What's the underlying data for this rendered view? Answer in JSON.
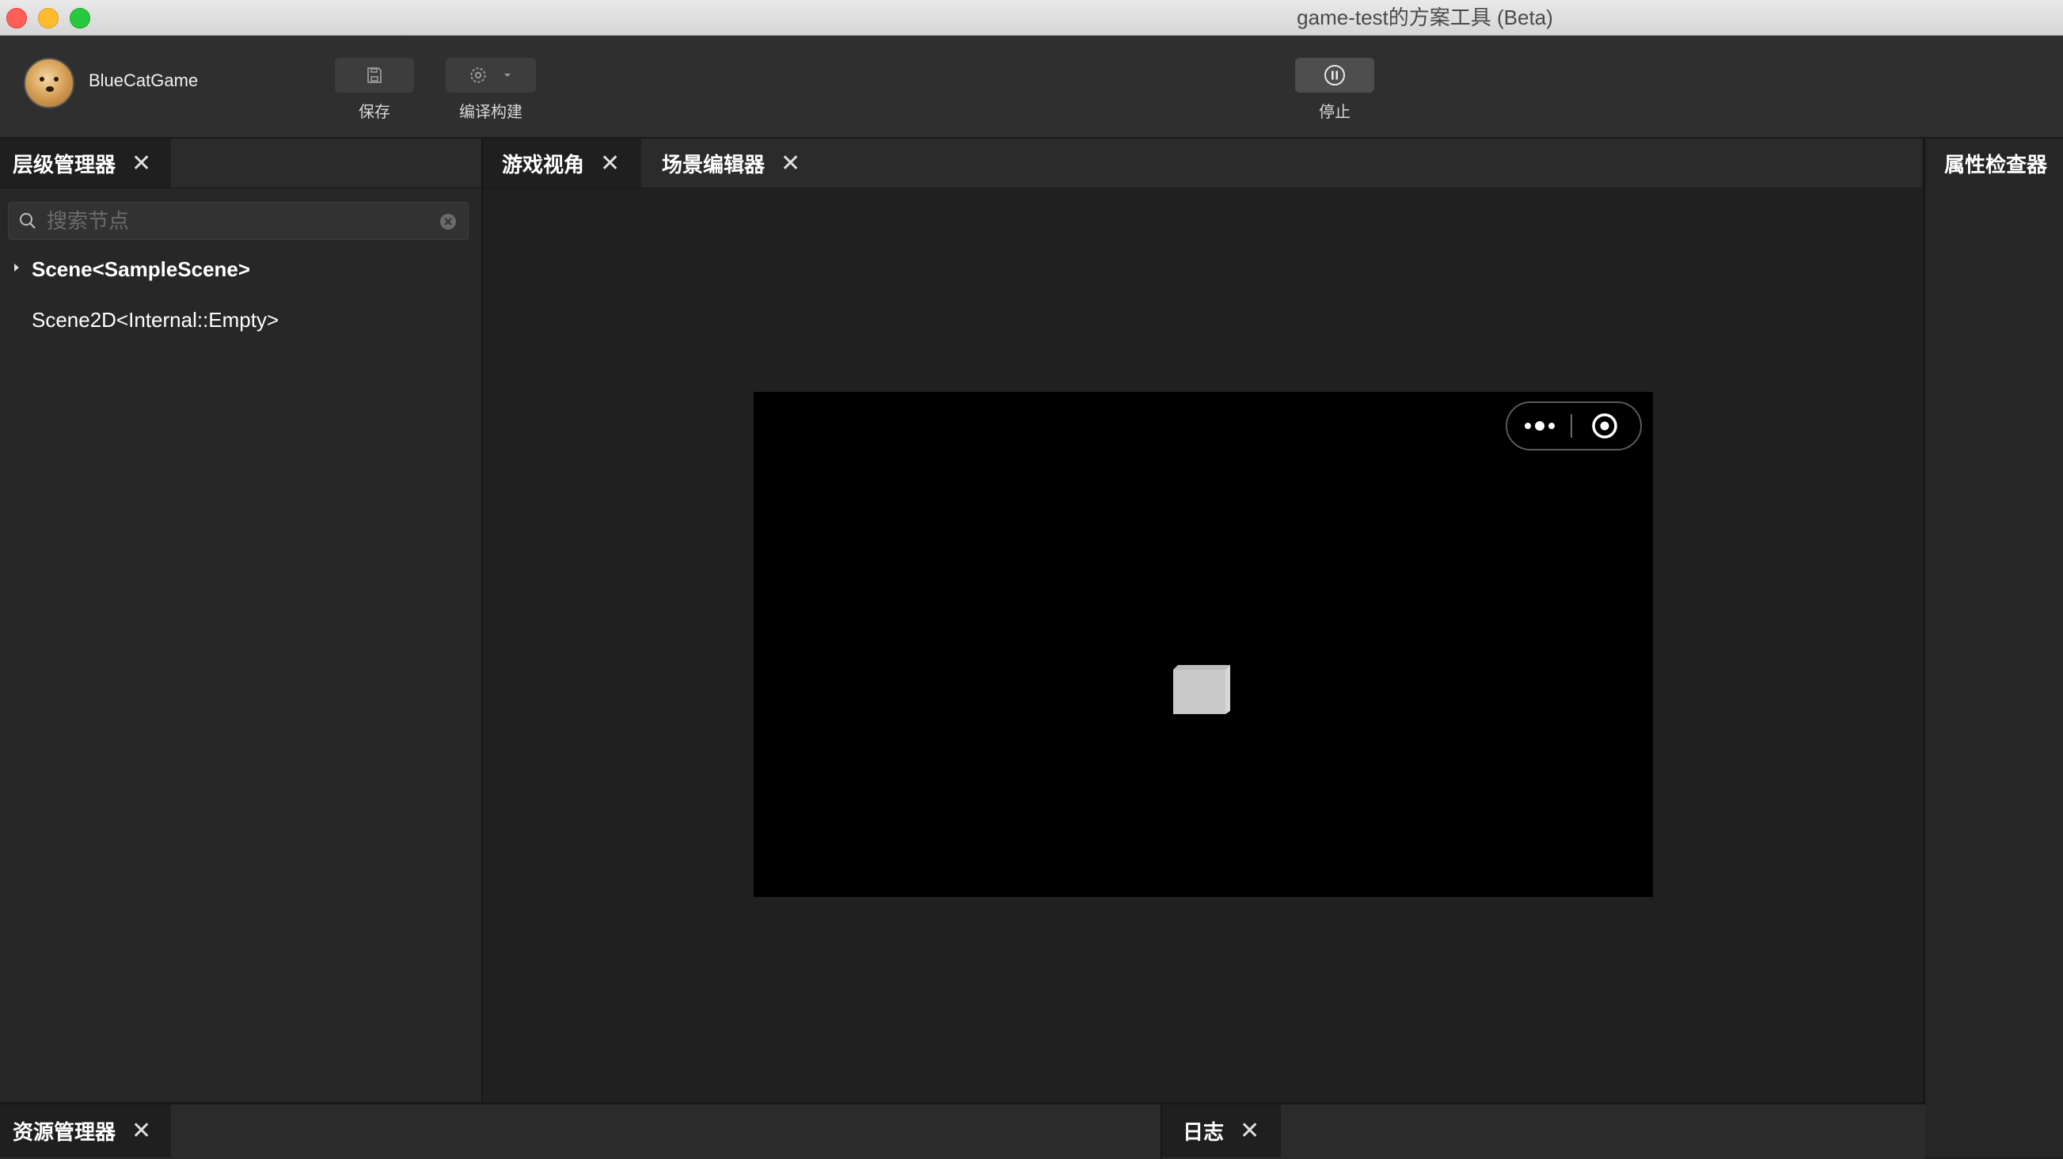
{
  "window": {
    "title": "game-test的方案工具 (Beta)"
  },
  "toolbar": {
    "username": "BlueCatGame",
    "save_label": "保存",
    "build_label": "编译构建",
    "stop_label": "停止"
  },
  "hierarchy": {
    "tab_label": "层级管理器",
    "search_placeholder": "搜索节点",
    "items": [
      {
        "label": "Scene<SampleScene>",
        "expandable": true,
        "bold": true
      },
      {
        "label": "Scene2D<Internal::Empty>",
        "expandable": false,
        "bold": false
      }
    ]
  },
  "center": {
    "tabs": [
      {
        "label": "游戏视角"
      },
      {
        "label": "场景编辑器"
      }
    ]
  },
  "inspector": {
    "tab_label": "属性检查器"
  },
  "bottom": {
    "assets_tab_label": "资源管理器",
    "log_tab_label": "日志"
  },
  "icons": {
    "save": "save-icon",
    "build": "gear-icon",
    "stop": "pause-icon",
    "more": "more-icon",
    "target": "target-icon",
    "search": "search-icon",
    "clear": "clear-icon"
  },
  "colors": {
    "background": "#1e1e1e",
    "panel": "#272727",
    "game_view": "#000000",
    "close_red": "#fe5f57",
    "minimize_yellow": "#febc2e",
    "zoom_green": "#28c840"
  }
}
